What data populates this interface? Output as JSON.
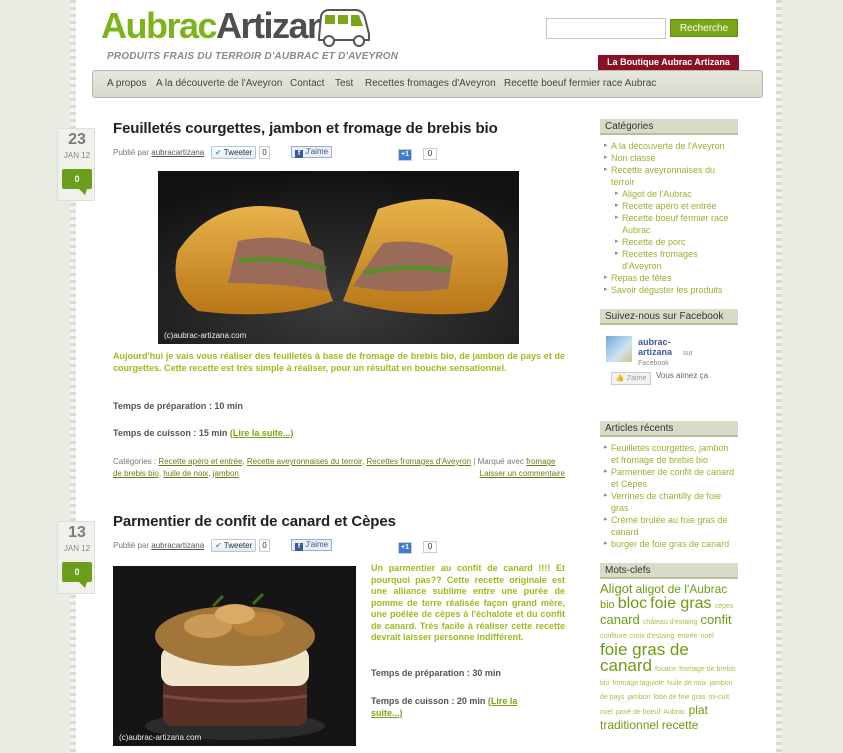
{
  "header": {
    "logo_part1": "Aubrac",
    "logo_part2": "Artizana",
    "tagline": "PRODUITS FRAIS DU TERROIR D'AUBRAC ET D'AVEYRON",
    "search_placeholder": "",
    "search_button": "Recherche",
    "boutique_label": "La Boutique Aubrac Artizana"
  },
  "nav": [
    "A propos",
    "A la découverte de l'Aveyron",
    "Contact",
    "Test",
    "Recettes fromages d'Aveyron",
    "Recette boeuf fermier race Aubrac"
  ],
  "posts": [
    {
      "day": "23",
      "month": "JAN 12",
      "comments": "0",
      "title": "Feuilletés courgettes, jambon et fromage de brebis bio",
      "meta_prefix": "Publié par",
      "author": "aubracartizana",
      "tweet": "Tweeter",
      "tweet_count": "0",
      "like": "J'aime",
      "gplus": "+1",
      "gplus_count": "0",
      "watermark": "(c)aubrac-artizana.com",
      "excerpt": "Aujourd'hui je vais vous réaliser des feuilletés à base de fromage de brebis bio, de jambon de pays et de courgettes. Cette recette est très simple à réaliser, pour un résultat en bouche sensationnel.",
      "prep": "Temps de préparation : 10 min",
      "cook": "Temps de cuisson : 15 min",
      "more": "(Lire la suite...)",
      "cats_prefix": "Catégories :",
      "cats": [
        "Recette apéro et entrée",
        "Recette aveyronnaises du terroir",
        "Recettes fromages d'Aveyron"
      ],
      "tags_prefix": "| Marqué avec",
      "tags": [
        "fromage de brebis bio",
        "huile de noix",
        "jambon"
      ],
      "leave_comment": "Laisser un commentaire"
    },
    {
      "day": "13",
      "month": "JAN 12",
      "comments": "0",
      "title": "Parmentier de confit de canard et Cèpes",
      "meta_prefix": "Publié par",
      "author": "aubracartizana",
      "tweet": "Tweeter",
      "tweet_count": "0",
      "like": "J'aime",
      "gplus": "+1",
      "gplus_count": "0",
      "watermark": "(c)aubrac-artizana.com",
      "excerpt": "Un parmentier au confit de canard !!!! Et pourquoi pas?? Cette recette originale est une alliance sublime entre une purée de pomme de terre réalisée façon grand mère, une poêlée de cèpes à l'échalote et du confit de canard. Très facile à réaliser cette recette devrait laisser personne indifférent.",
      "prep": "Temps de préparation : 30 min",
      "cook": "Temps de cuisson : 20 min",
      "more": "(Lire la suite...)"
    }
  ],
  "sidebar": {
    "categories_title": "Catégories",
    "categories": [
      {
        "label": "A la découverte de l'Aveyron",
        "sub": false
      },
      {
        "label": "Non classé",
        "sub": false
      },
      {
        "label": "Recette aveyronnaises du terroir",
        "sub": false
      },
      {
        "label": "Aligot de l'Aubrac",
        "sub": true
      },
      {
        "label": "Recette apéro et entrée",
        "sub": true
      },
      {
        "label": "Recette boeuf fermier race Aubrac",
        "sub": true
      },
      {
        "label": "Recette de porc",
        "sub": true
      },
      {
        "label": "Recettes fromages d'Aveyron",
        "sub": true
      },
      {
        "label": "Repas de fêtes",
        "sub": false
      },
      {
        "label": "Savoir déguster les produits",
        "sub": false
      }
    ],
    "facebook_title": "Suivez-nous sur Facebook",
    "fb_name_1": "aubrac-",
    "fb_name_2": "artizana",
    "fb_sur": "sur",
    "fb_facebook": "Facebook",
    "fb_like": "J'aime",
    "fb_vous": "Vous aimez ça.",
    "recent_title": "Articles récents",
    "recent": [
      "Feuilletés courgettes, jambon et fromage de brebis bio",
      "Parmentier de confit de canard et Cèpes",
      "Verrines de chantilly de foie gras",
      "Crème brulée au foie gras de canard",
      "burger de foie gras de canard"
    ],
    "tags_title": "Mots-clefs",
    "tags": [
      {
        "t": "Aligot",
        "size": 13
      },
      {
        "t": "aligot de l'Aubrac",
        "size": 12
      },
      {
        "t": "bio",
        "size": 11
      },
      {
        "t": "bloc",
        "size": 16
      },
      {
        "t": "foie gras",
        "size": 16
      },
      {
        "t": "cèpes",
        "size": 7
      },
      {
        "t": "canard",
        "size": 13
      },
      {
        "t": "château d'estaing",
        "size": 7
      },
      {
        "t": "confit",
        "size": 13
      },
      {
        "t": "confiture",
        "size": 7
      },
      {
        "t": "croix d'estaing",
        "size": 7
      },
      {
        "t": "entrée",
        "size": 7
      },
      {
        "t": "noël",
        "size": 7
      },
      {
        "t": "foie gras de canard",
        "size": 17
      },
      {
        "t": "fouace",
        "size": 7
      },
      {
        "t": "fromage de brebis bio",
        "size": 7
      },
      {
        "t": "fromage laguiole",
        "size": 7
      },
      {
        "t": "huile de noix",
        "size": 7
      },
      {
        "t": "jambon de pays",
        "size": 7
      },
      {
        "t": "jambon",
        "size": 7
      },
      {
        "t": "lobe de foie gras",
        "size": 7
      },
      {
        "t": "mi-cuit",
        "size": 7
      },
      {
        "t": "miel",
        "size": 7
      },
      {
        "t": "pavé de boeuf",
        "size": 7
      },
      {
        "t": "Aubrac",
        "size": 7
      },
      {
        "t": "plat",
        "size": 12
      },
      {
        "t": "traditionnel",
        "size": 12
      },
      {
        "t": "recette",
        "size": 12
      }
    ]
  },
  "colors": {
    "green": "#7aa61a",
    "excerpt_green": "#9bbd1e",
    "boutique": "#8b1026"
  }
}
